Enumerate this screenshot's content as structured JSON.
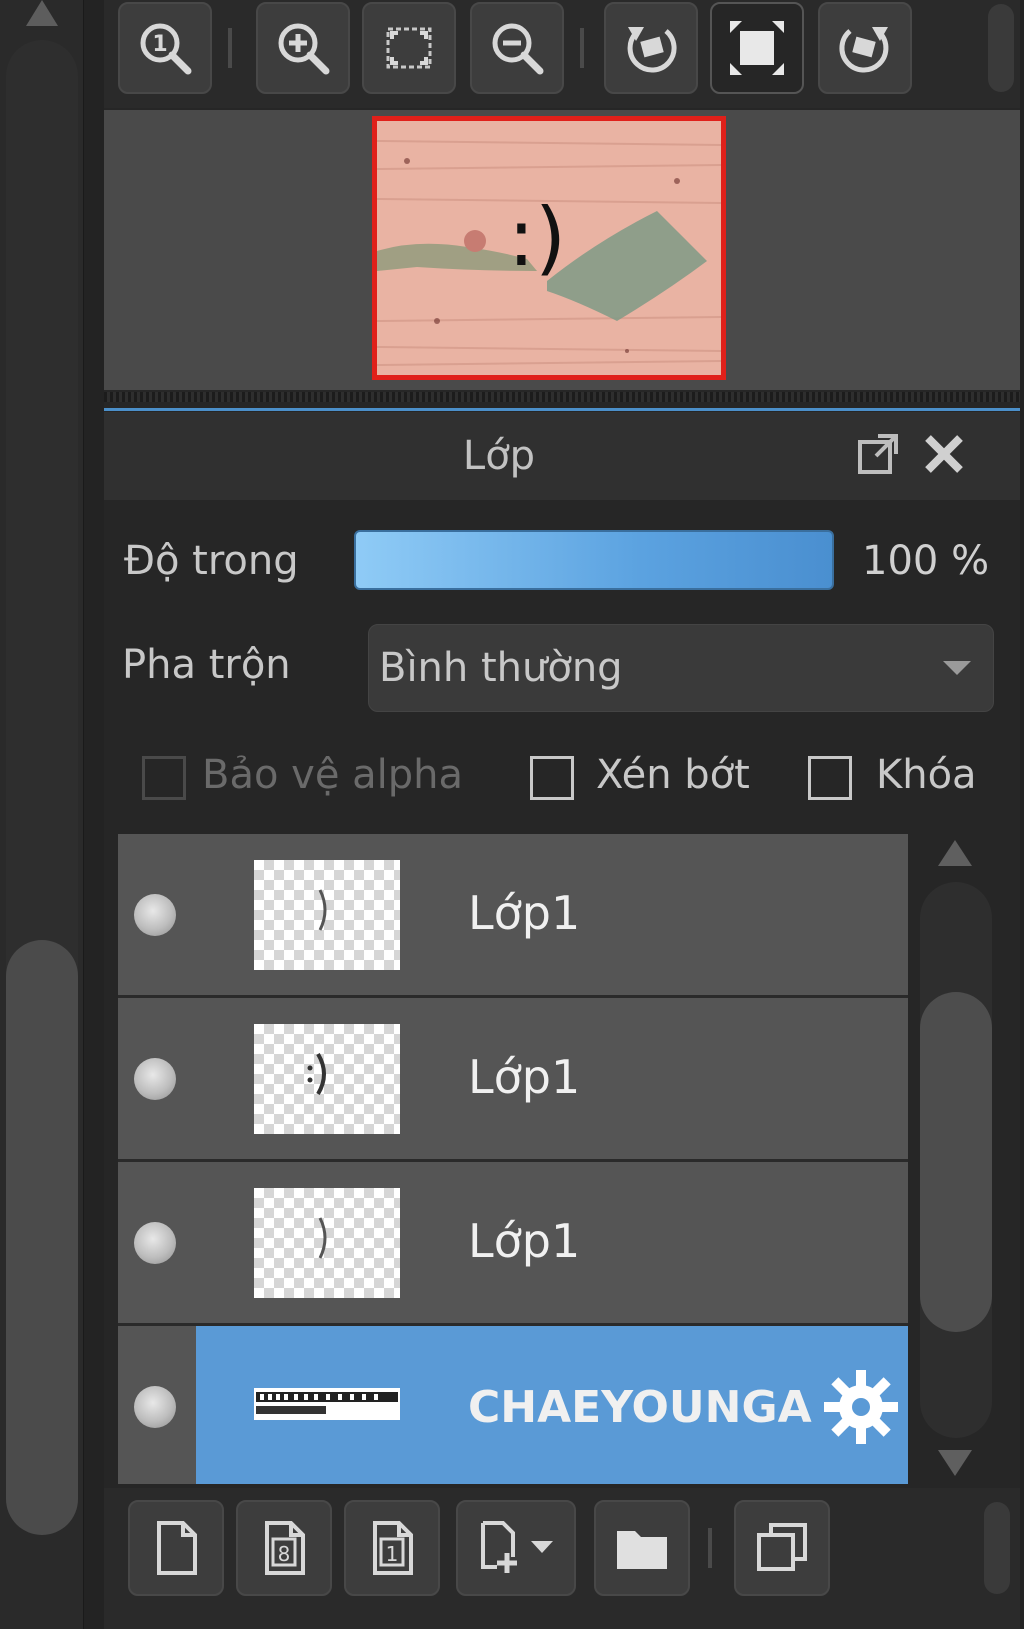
{
  "navigator": {
    "toolbar": [
      {
        "id": "zoom-actual",
        "icon": "zoom-actual-size-icon"
      },
      {
        "id": "zoom-in",
        "icon": "zoom-in-icon"
      },
      {
        "id": "fit",
        "icon": "fit-to-window-icon"
      },
      {
        "id": "zoom-out",
        "icon": "zoom-out-icon"
      },
      {
        "id": "rotate-left",
        "icon": "rotate-left-icon"
      },
      {
        "id": "flip",
        "icon": "flip-frame-icon",
        "active": true
      },
      {
        "id": "rotate-right",
        "icon": "rotate-right-icon"
      }
    ],
    "preview_text": ":)"
  },
  "layer_panel": {
    "title": "Lớp",
    "opacity_label": "Độ trong",
    "opacity_value": "100 %",
    "opacity_percent": 100,
    "blend_label": "Pha trộn",
    "blend_value": "Bình thường",
    "protect_alpha_label": "Bảo vệ alpha",
    "clipping_label": "Xén bớt",
    "lock_label": "Khóa",
    "layers": [
      {
        "name": "Lớp1",
        "visible": true,
        "selected": false
      },
      {
        "name": "Lớp1",
        "visible": true,
        "selected": false
      },
      {
        "name": "Lớp1",
        "visible": true,
        "selected": false
      },
      {
        "name": "CHAEYOUNGA",
        "visible": true,
        "selected": true
      }
    ]
  },
  "bottom_toolbar": [
    {
      "id": "new-layer",
      "icon": "new-layer-icon"
    },
    {
      "id": "new-8bit-layer",
      "icon": "new-8bit-layer-icon"
    },
    {
      "id": "new-1bit-layer",
      "icon": "new-1bit-layer-icon"
    },
    {
      "id": "add-layer-menu",
      "icon": "add-layer-dropdown-icon"
    },
    {
      "id": "new-folder",
      "icon": "folder-icon"
    },
    {
      "id": "duplicate-layer",
      "icon": "duplicate-layer-icon"
    }
  ],
  "colors": {
    "accent": "#5a9ad6",
    "frame_red": "#e0201a",
    "panel_bg": "#262626"
  }
}
